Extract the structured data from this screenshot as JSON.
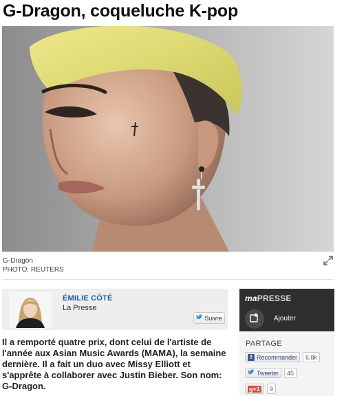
{
  "article": {
    "title": "G-Dragon, coqueluche K-pop",
    "photo_caption": "G-Dragon",
    "photo_credit": "PHOTO: REUTERS",
    "body": "Il a remporté quatre prix, dont celui de l'artiste de l'année aux Asian Music Awards (MAMA), la semaine dernière. Il a fait un duo avec Missy Elliott et s'apprête à collaborer avec Justin Bieber. Son nom: G-Dragon."
  },
  "author": {
    "name": "ÉMILIE CÔTÉ",
    "organization": "La Presse",
    "follow_label": "Suivre"
  },
  "sidebar": {
    "logo_ma": "ma",
    "logo_presse": "PRESSE",
    "add_label": "Ajouter",
    "share_heading": "PARTAGE",
    "facebook_label": "Recommander",
    "facebook_count": "6,8k",
    "twitter_label": "Tweeter",
    "twitter_count": "45",
    "gplus_label": "g+1",
    "gplus_count": "9"
  },
  "colors": {
    "author_link": "#1a5ea8",
    "sidebar_header": "#2f2f2f",
    "hair": "#d9d96a"
  },
  "icons": [
    "expand-icon",
    "twitter-bird-icon",
    "add-icon",
    "facebook-icon"
  ]
}
